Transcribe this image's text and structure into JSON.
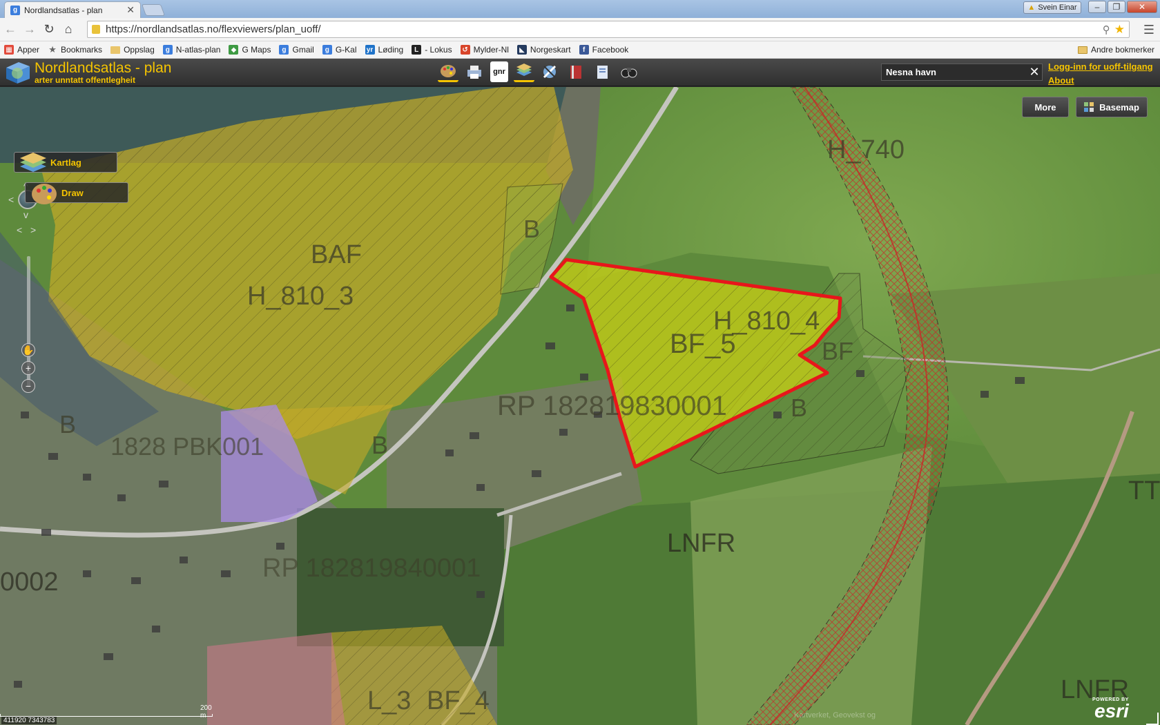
{
  "browser": {
    "tab_title": "Nordlandsatlas - plan",
    "tab_favicon": "g-icon",
    "user_name": "Svein Einar",
    "url": "https://nordlandsatlas.no/flexviewers/plan_uoff/",
    "bookmarks": [
      {
        "label": "Apper",
        "icon": "apps-grid-icon",
        "color": "#e24a3b"
      },
      {
        "label": "Bookmarks",
        "icon": "star-icon",
        "color": "#666666"
      },
      {
        "label": "Oppslag",
        "icon": "folder-icon",
        "color": "#e9c56b"
      },
      {
        "label": "N-atlas-plan",
        "icon": "g-icon",
        "color": "#3b7ddd"
      },
      {
        "label": "G Maps",
        "icon": "maps-icon",
        "color": "#3e9a43"
      },
      {
        "label": "Gmail",
        "icon": "g-icon",
        "color": "#3b7ddd"
      },
      {
        "label": "G-Kal",
        "icon": "g-icon",
        "color": "#3b7ddd"
      },
      {
        "label": "Løding",
        "icon": "yr-icon",
        "color": "#1f73c9"
      },
      {
        "label": "- Lokus",
        "icon": "l-icon",
        "color": "#222222"
      },
      {
        "label": "Mylder-Nl",
        "icon": "mylder-icon",
        "color": "#d8452a"
      },
      {
        "label": "Norgeskart",
        "icon": "norgeskart-icon",
        "color": "#243a5e"
      },
      {
        "label": "Facebook",
        "icon": "facebook-icon",
        "color": "#3b5998"
      }
    ],
    "other_bookmarks": "Andre bokmerker"
  },
  "app": {
    "title": "Nordlandsatlas - plan",
    "subtitle": "arter unntatt offentlegheit",
    "accent": "#f5c400",
    "tools": [
      {
        "name": "draw-palette-tool",
        "label": ""
      },
      {
        "name": "print-tool",
        "label": ""
      },
      {
        "name": "gnr-tool",
        "label": "gnr"
      },
      {
        "name": "layers-tool",
        "label": ""
      },
      {
        "name": "measure-tool",
        "label": ""
      },
      {
        "name": "book-tool",
        "label": ""
      },
      {
        "name": "document-tool",
        "label": ""
      },
      {
        "name": "binoculars-tool",
        "label": ""
      }
    ],
    "search": {
      "value": "Nesna havn",
      "clear": "✕"
    },
    "links": {
      "login": "Logg-inn for uoff-tilgang",
      "about": "About"
    }
  },
  "map": {
    "buttons": {
      "more": "More",
      "basemap": "Basemap"
    },
    "panels": {
      "layers": "Kartlag",
      "draw": "Draw"
    },
    "labels": {
      "baf": "BAF",
      "h810_3": "H_810_3",
      "h810_4": "H_810_4",
      "bf5": "BF_5",
      "h740": "H_740",
      "rp_1828": "RP 182819830001",
      "rp_1828_b": "RP 182819840001",
      "lnfr": "LNFR",
      "lnfr_b": "LNFR",
      "b1": "B",
      "b2": "B",
      "b3": "B",
      "b4": "B",
      "bf": "BF",
      "bf4": "BF_4",
      "l3": "L_3",
      "code_left": "0002",
      "tt": "TT",
      "lower_left": "1828 PBK001"
    },
    "scale": "200 m",
    "coords": "411920 7343783",
    "esri_small": "POWERED BY",
    "esri_big": "esri",
    "attribution": "Kartverket, Geovekst og"
  }
}
